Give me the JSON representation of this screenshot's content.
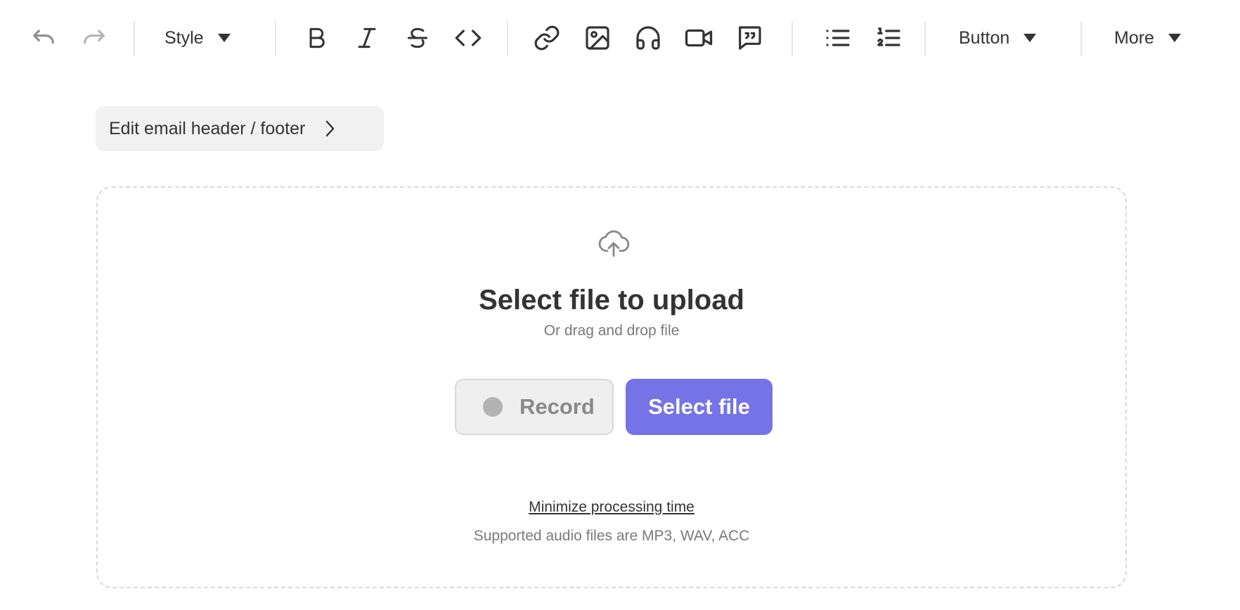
{
  "toolbar": {
    "undo_icon": "undo-icon",
    "redo_icon": "redo-icon",
    "style_label": "Style",
    "bold_icon": "bold-icon",
    "italic_icon": "italic-icon",
    "strikethrough_icon": "strikethrough-icon",
    "code_icon": "code-icon",
    "link_icon": "link-icon",
    "image_icon": "image-icon",
    "audio_icon": "headphones-icon",
    "video_icon": "video-camera-icon",
    "quote_icon": "quote-bubble-icon",
    "bullet_list_icon": "bullet-list-icon",
    "numbered_list_icon": "numbered-list-icon",
    "button_label": "Button",
    "more_label": "More"
  },
  "header_footer": {
    "label": "Edit email header / footer"
  },
  "upload": {
    "icon": "cloud-upload-icon",
    "title": "Select file to upload",
    "subtitle": "Or drag and drop file",
    "record_label": "Record",
    "select_label": "Select file",
    "minimize_link": "Minimize processing time",
    "supported_text": "Supported audio files are MP3, WAV, ACC"
  },
  "colors": {
    "accent": "#7673e6",
    "text": "#333333",
    "muted": "#7a7a7a",
    "disabled_icon": "#8a8a8a"
  }
}
